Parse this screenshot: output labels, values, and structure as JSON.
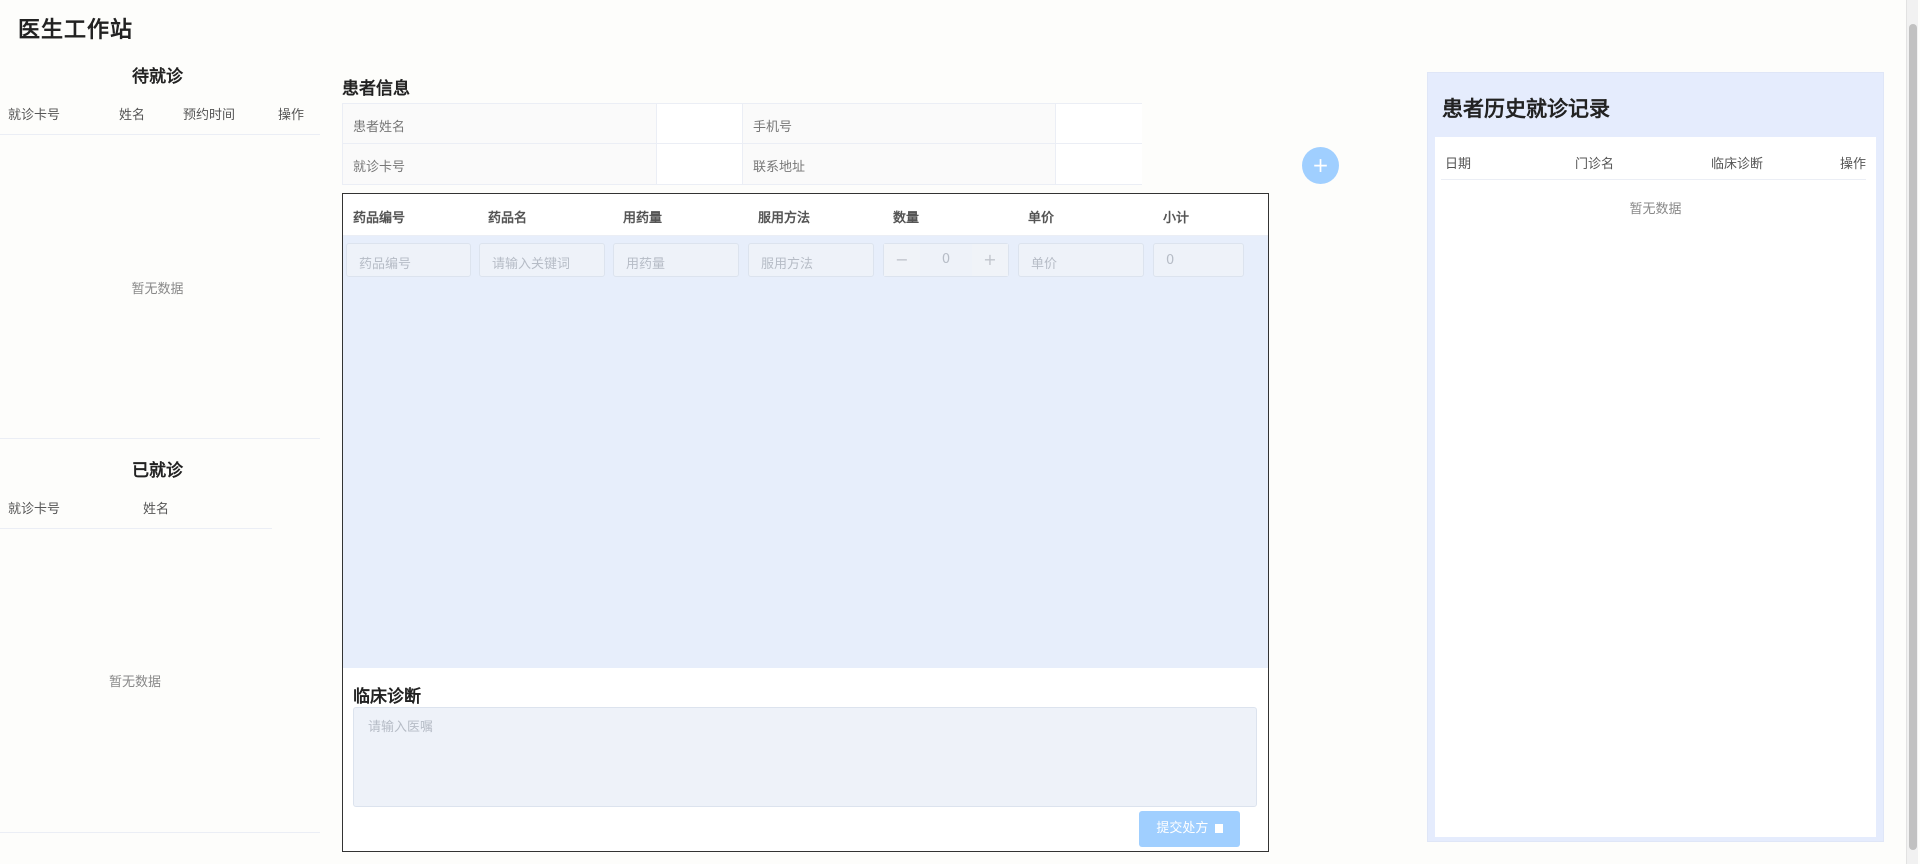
{
  "app": {
    "title": "医生工作站"
  },
  "waiting": {
    "title": "待就诊",
    "columns": [
      "就诊卡号",
      "姓名",
      "预约时间",
      "操作"
    ],
    "empty_text": "暂无数据"
  },
  "done": {
    "title": "已就诊",
    "columns": [
      "就诊卡号",
      "姓名"
    ],
    "empty_text": "暂无数据"
  },
  "patient_info": {
    "title": "患者信息",
    "name_label": "患者姓名",
    "phone_label": "手机号",
    "card_label": "就诊卡号",
    "address_label": "联系地址"
  },
  "prescription": {
    "columns": [
      "药品编号",
      "药品名",
      "用药量",
      "服用方法",
      "数量",
      "单价",
      "小计"
    ],
    "row": {
      "code_placeholder": "药品编号",
      "name_placeholder": "请输入关键词",
      "dosage_placeholder": "用药量",
      "usage_placeholder": "服用方法",
      "quantity": "0",
      "minus": "−",
      "plus": "+",
      "price_placeholder": "单价",
      "subtotal": "0"
    },
    "diagnosis_title": "临床诊断",
    "diagnosis_placeholder": "请输入医嘱",
    "submit_label": "提交处方"
  },
  "add_button": {
    "label": "+"
  },
  "history": {
    "title": "患者历史就诊记录",
    "columns": [
      "日期",
      "门诊名",
      "临床诊断",
      "操作"
    ],
    "empty_text": "暂无数据"
  },
  "colors": {
    "primary_light": "#a0cfff",
    "table_body_bg": "#e7eefb",
    "history_bg": "#e5ecfd"
  }
}
